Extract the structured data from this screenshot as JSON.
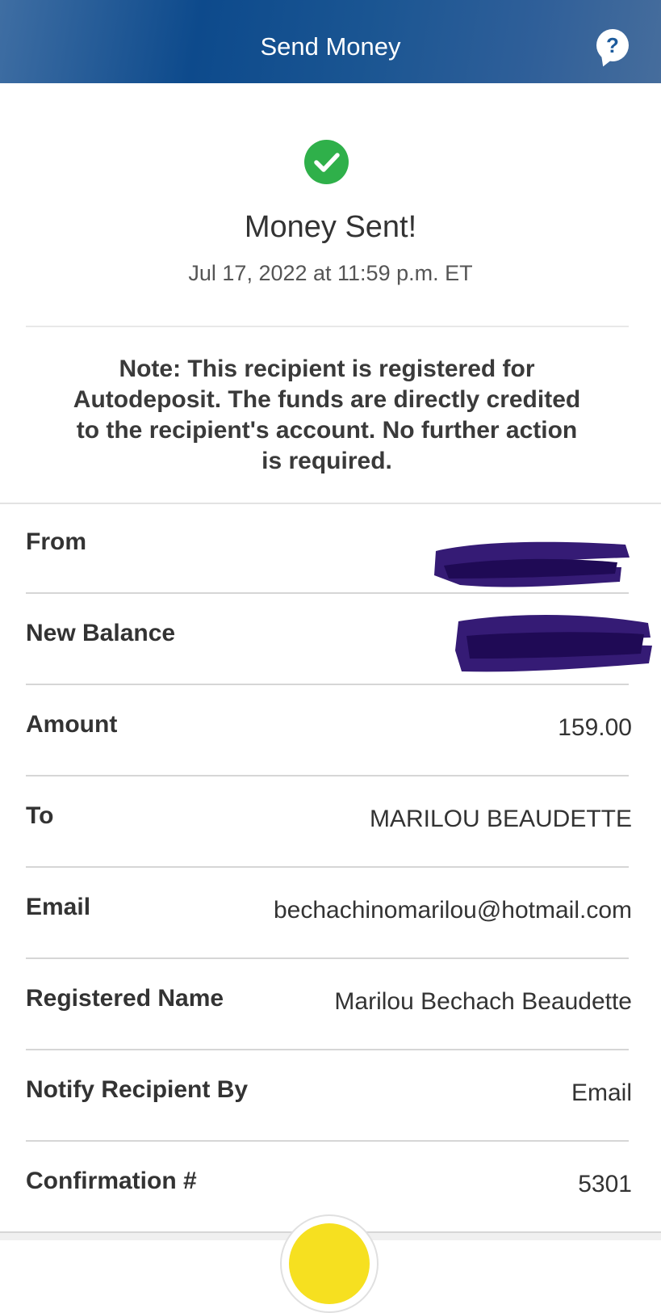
{
  "header": {
    "title": "Send Money",
    "help_icon": "help-chat-icon",
    "help_label": "?"
  },
  "status": {
    "icon": "success-check-icon",
    "title": "Money Sent!",
    "datetime": "Jul 17, 2022 at 11:59 p.m. ET",
    "accent_color": "#2fb04a"
  },
  "note": "Note: This recipient is registered for Autodeposit. The funds are directly credited to the recipient's account. No further action is required.",
  "details": [
    {
      "label": "From",
      "value": "",
      "redacted": true
    },
    {
      "label": "New Balance",
      "value": "",
      "redacted": true
    },
    {
      "label": "Amount",
      "value": "159.00"
    },
    {
      "label": "To",
      "value": "MARILOU BEAUDETTE"
    },
    {
      "label": "Email",
      "value": "bechachinomarilou@hotmail.com"
    },
    {
      "label": "Registered Name",
      "value": "Marilou Bechach Beaudette"
    },
    {
      "label": "Notify Recipient By",
      "value": "Email"
    },
    {
      "label": "Confirmation #",
      "value": "5301"
    }
  ],
  "colors": {
    "header": "#0d4a8c",
    "redaction": "#2a0f6e",
    "fab": "#f6e020"
  }
}
